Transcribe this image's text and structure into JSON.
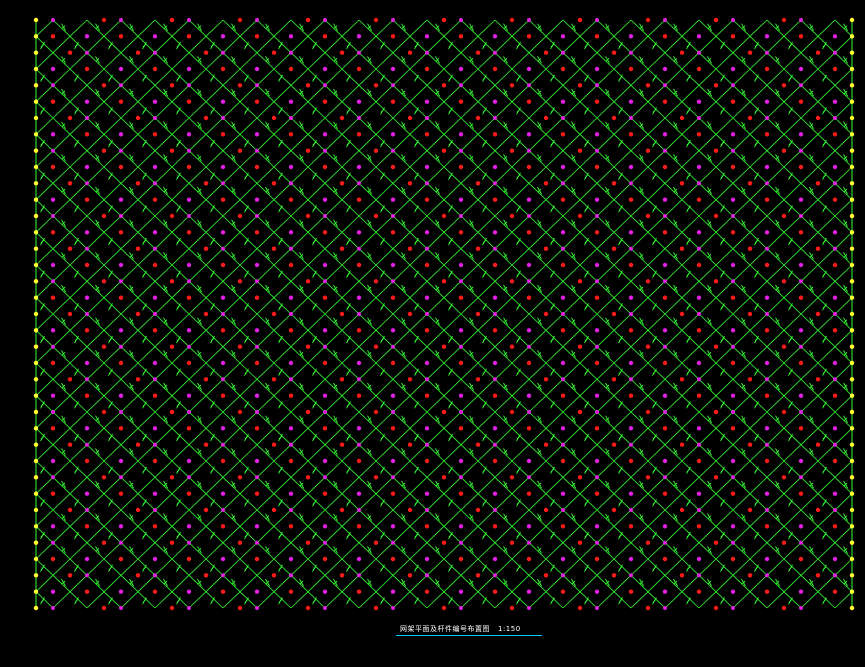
{
  "drawing": {
    "title": "网架平面及杆件编号布置图",
    "scale": "1:150"
  },
  "grid": {
    "columns": 24,
    "rows": 18,
    "member_color": "#33ff33",
    "top_node_color": "#ff1a1a",
    "bottom_node_color": "#e020e0",
    "support_node_color": "#ffff33",
    "title_underline_color": "#00c8ff",
    "background": "#000000"
  }
}
